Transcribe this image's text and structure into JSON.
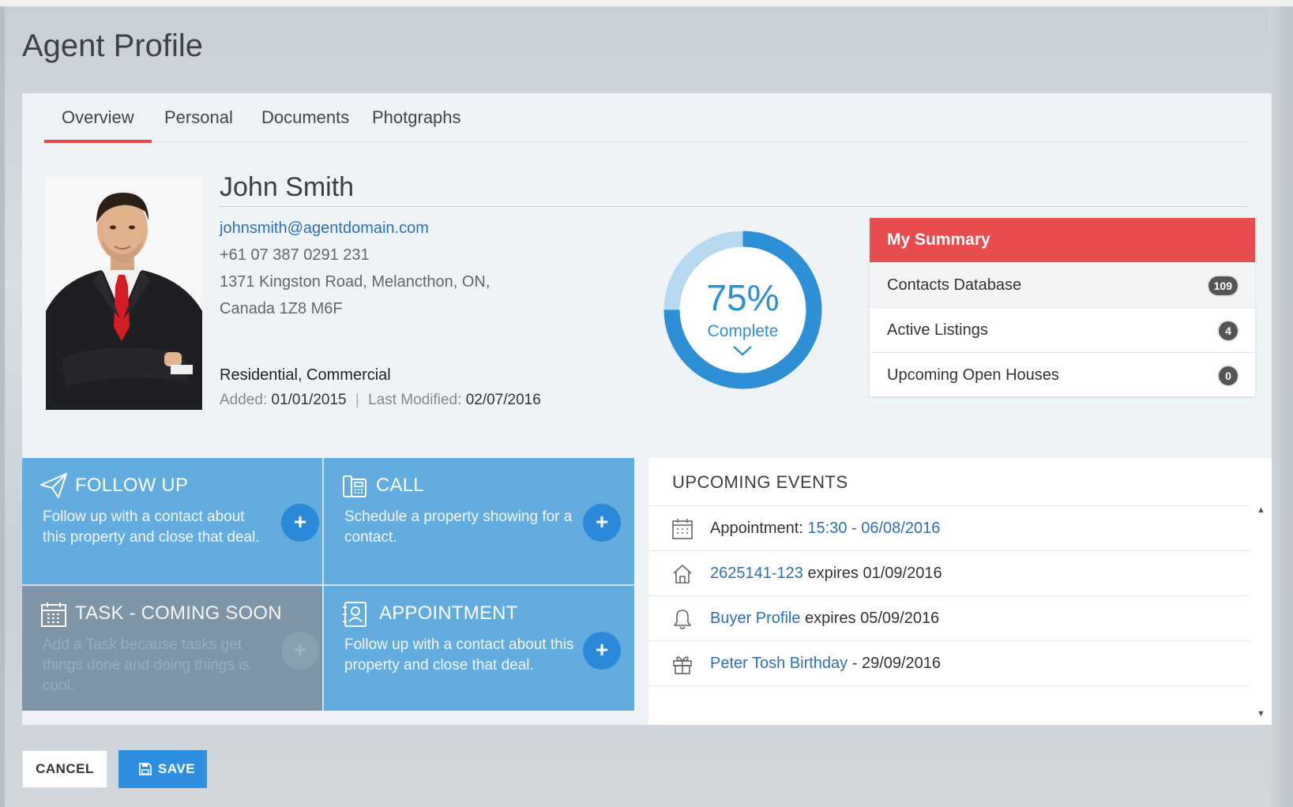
{
  "page": {
    "title": "Agent Profile"
  },
  "tabs": [
    {
      "label": "Overview",
      "active": true
    },
    {
      "label": "Personal",
      "active": false
    },
    {
      "label": "Documents",
      "active": false
    },
    {
      "label": "Photgraphs",
      "active": false
    }
  ],
  "agent": {
    "name": "John Smith",
    "email": "johnsmith@agentdomain.com",
    "phone": "+61 07 387 0291 231",
    "address_line1": "1371 Kingston Road, Melancthon, ON,",
    "address_line2": "Canada 1Z8 M6F",
    "types": "Residential, Commercial",
    "added_label": "Added:",
    "added_value": "01/01/2015",
    "modified_label": "Last Modified:",
    "modified_value": "02/07/2016"
  },
  "progress": {
    "value_text": "75%",
    "label": "Complete",
    "fraction": 0.75,
    "color": "#2d8fd6",
    "track_color": "#b7d8f1"
  },
  "summary": {
    "title": "My Summary",
    "header_color": "#e84c4c",
    "rows": [
      {
        "label": "Contacts Database",
        "count": "109"
      },
      {
        "label": "Active Listings",
        "count": "4"
      },
      {
        "label": "Upcoming Open Houses",
        "count": "0"
      }
    ]
  },
  "tiles": [
    {
      "title": "FOLLOW UP",
      "desc": "Follow up with a contact about this property and close that deal.",
      "icon": "paper-plane-icon",
      "enabled": true
    },
    {
      "title": "CALL",
      "desc": "Schedule a property showing for a contact.",
      "icon": "phone-icon",
      "enabled": true
    },
    {
      "title": "TASK - COMING SOON",
      "desc": "Add a Task because tasks get things done and doing things is cool.",
      "icon": "calendar-icon",
      "enabled": false
    },
    {
      "title": "APPOINTMENT",
      "desc": "Follow up with a contact about this property and close that deal.",
      "icon": "contact-card-icon",
      "enabled": true
    }
  ],
  "events": {
    "title": "UPCOMING EVENTS",
    "items": [
      {
        "icon": "calendar-icon",
        "prefix": "Appointment: ",
        "link": "15:30 - 06/08/2016",
        "suffix": ""
      },
      {
        "icon": "house-icon",
        "prefix": "",
        "link": "2625141-123",
        "suffix": " expires 01/09/2016"
      },
      {
        "icon": "bell-icon",
        "prefix": "",
        "link": "Buyer Profile",
        "suffix": " expires 05/09/2016"
      },
      {
        "icon": "gift-icon",
        "prefix": "",
        "link": "Peter Tosh Birthday",
        "suffix": " - 29/09/2016"
      }
    ]
  },
  "actions": {
    "cancel_label": "CANCEL",
    "save_label": "SAVE",
    "save_icon": "floppy-disk-icon"
  }
}
